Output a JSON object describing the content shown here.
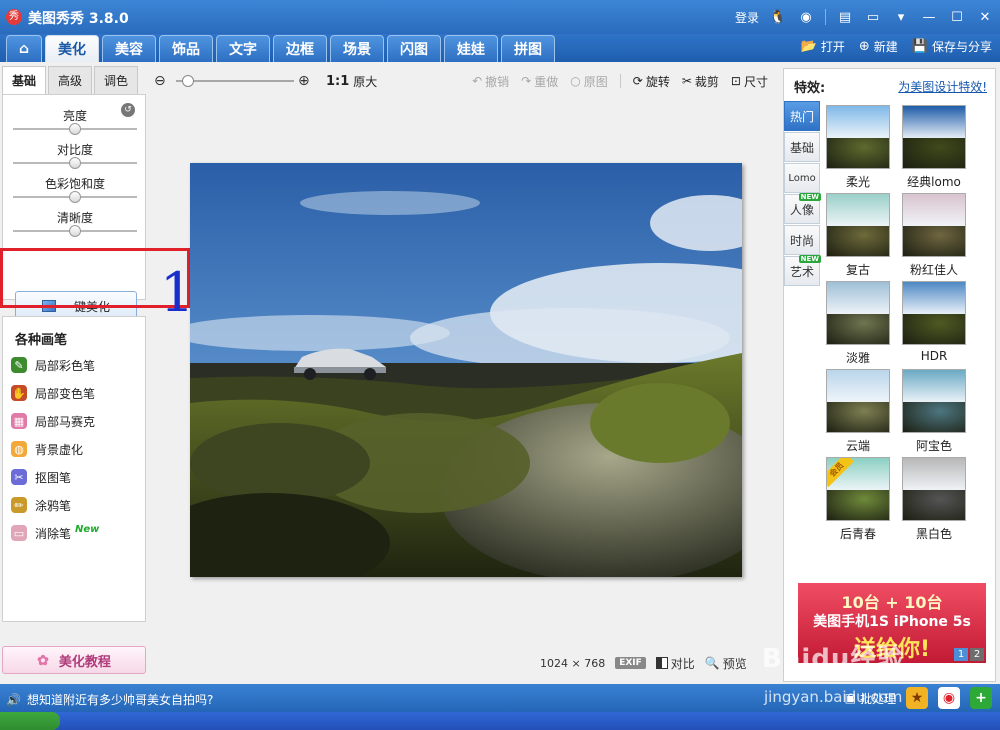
{
  "app": {
    "title": "美图秀秀 3.8.0",
    "logo": "秀"
  },
  "titlebar": {
    "login": "登录"
  },
  "tabs": [
    {
      "label": "美化",
      "active": true
    },
    {
      "label": "美容"
    },
    {
      "label": "饰品"
    },
    {
      "label": "文字"
    },
    {
      "label": "边框"
    },
    {
      "label": "场景"
    },
    {
      "label": "闪图"
    },
    {
      "label": "娃娃"
    },
    {
      "label": "拼图"
    }
  ],
  "tab_actions": {
    "open": "打开",
    "new": "新建",
    "save": "保存与分享"
  },
  "left": {
    "subtabs": [
      "基础",
      "高级",
      "调色"
    ],
    "sliders": [
      {
        "label": "亮度",
        "value": 0.5
      },
      {
        "label": "对比度",
        "value": 0.5
      },
      {
        "label": "色彩饱和度",
        "value": 0.5
      },
      {
        "label": "清晰度",
        "value": 0.5
      }
    ],
    "oneclick": "一键美化",
    "annotation": "1",
    "brush_title": "各种画笔",
    "brushes": [
      "局部彩色笔",
      "局部变色笔",
      "局部马赛克",
      "背景虚化",
      "抠图笔",
      "涂鸦笔",
      "消除笔"
    ],
    "new_badge": "New",
    "tutorial": "美化教程"
  },
  "toolbar": {
    "zoom": 0.05,
    "ratio": "1:1",
    "original_size": "原大",
    "undo": "撤销",
    "redo": "重做",
    "original": "原图",
    "rotate": "旋转",
    "crop": "裁剪",
    "size": "尺寸"
  },
  "canvas": {
    "dimensions": "1024 × 768",
    "exif": "EXIF",
    "compare": "对比",
    "preview": "预览"
  },
  "right": {
    "title": "特效:",
    "link": "为美图设计特效!",
    "categories": [
      {
        "label": "热门",
        "active": true
      },
      {
        "label": "基础"
      },
      {
        "label": "Lomo"
      },
      {
        "label": "人像",
        "badge": "NEW"
      },
      {
        "label": "时尚"
      },
      {
        "label": "艺术",
        "badge": "NEW"
      }
    ],
    "effects": [
      {
        "label": "柔光",
        "sky": "#7fb9e8",
        "land": "#5d6a2e"
      },
      {
        "label": "经典lomo",
        "sky": "#1e5ba8",
        "land": "#3f4a1a"
      },
      {
        "label": "复古",
        "sky": "#9ad0c9",
        "land": "#6e6a3a"
      },
      {
        "label": "粉红佳人",
        "sky": "#d8c3cf",
        "land": "#6f6640"
      },
      {
        "label": "淡雅",
        "sky": "#9fbfd6",
        "land": "#6f7550"
      },
      {
        "label": "HDR",
        "sky": "#4d88c4",
        "land": "#4e5a22"
      },
      {
        "label": "云端",
        "sky": "#b9d4ea",
        "land": "#7e7f52"
      },
      {
        "label": "阿宝色",
        "sky": "#6aa9c4",
        "land": "#4d7680"
      },
      {
        "label": "后青春",
        "sky": "#8bd0c2",
        "land": "#6f8a3a",
        "vip": "会员"
      },
      {
        "label": "黑白色",
        "sky": "#b7b7b7",
        "land": "#555555"
      }
    ],
    "ad": {
      "line1": "10台 + 10台",
      "line2": "美图手机1S iPhone 5s",
      "line3": "送给你!",
      "pages": [
        "1",
        "2"
      ]
    }
  },
  "status": {
    "message": "想知道附近有多少帅哥美女自拍吗?",
    "batch": "批处理"
  },
  "watermark": {
    "brand": "Baidu经验",
    "url": "jingyan.baidu.com"
  },
  "colors": {
    "accent": "#2a6bbd",
    "highlight": "#e0202a",
    "annotation": "#1a2ecc"
  }
}
